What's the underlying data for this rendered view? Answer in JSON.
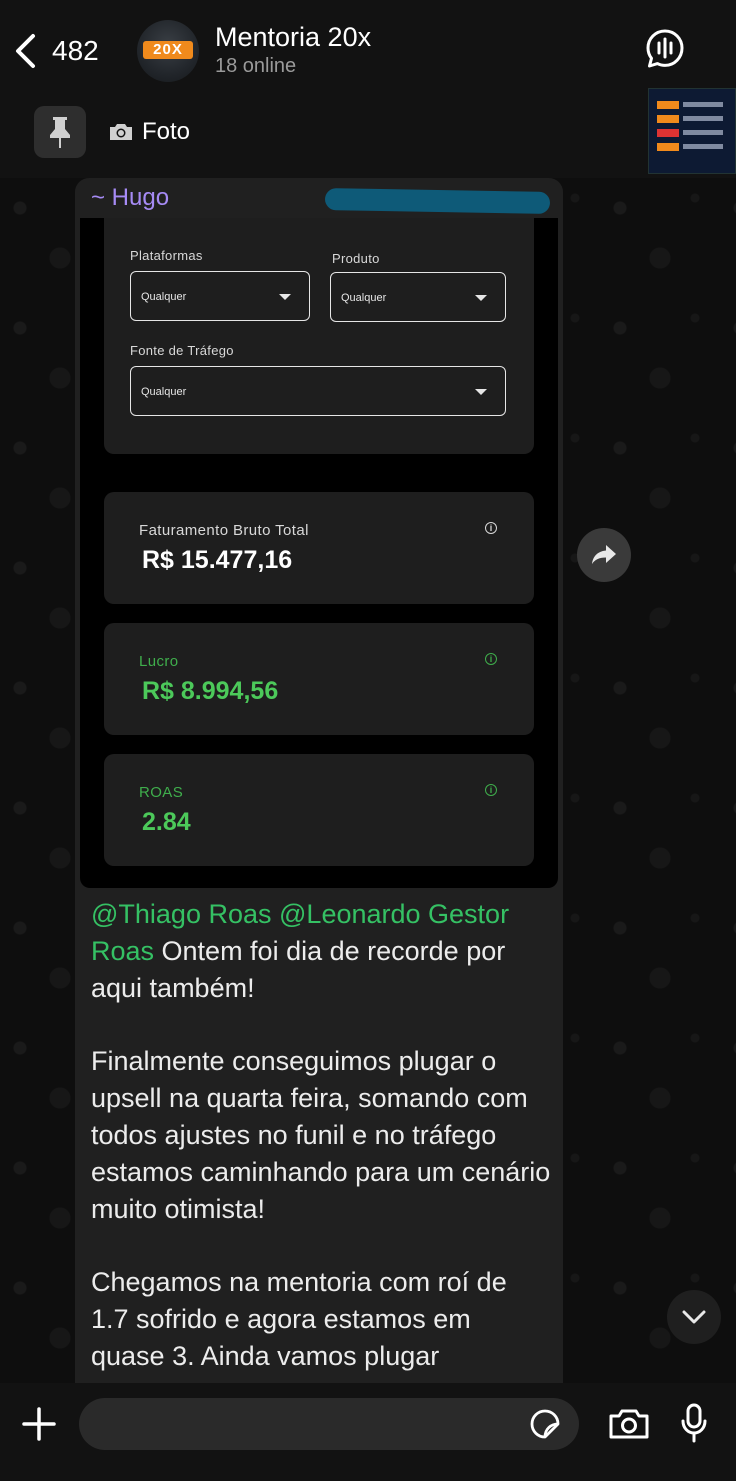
{
  "header": {
    "back_count": "482",
    "avatar_badge": "20X",
    "title": "Mentoria 20x",
    "status": "18 online"
  },
  "pinned": {
    "label": "Foto"
  },
  "message": {
    "sender": "~ Hugo",
    "screenshot": {
      "filters": [
        {
          "label": "Plataformas",
          "value": "Qualquer"
        },
        {
          "label": "Produto",
          "value": "Qualquer"
        },
        {
          "label": "Fonte de Tráfego",
          "value": "Qualquer"
        }
      ],
      "metrics": [
        {
          "label": "Faturamento Bruto Total",
          "value": "R$ 15.477,16",
          "color": "#ffffff",
          "label_color": "#d8d8d8"
        },
        {
          "label": "Lucro",
          "value": "R$ 8.994,56",
          "color": "#4cc95a",
          "label_color": "#3fae4c"
        },
        {
          "label": "ROAS",
          "value": "2.84",
          "color": "#4cc95a",
          "label_color": "#3fae4c"
        }
      ]
    },
    "mention_1": "@Thiago Roas",
    "mention_2": "@Leonardo Gestor Roas",
    "paragraph_1_rest": " Ontem foi dia de recorde por aqui também!",
    "paragraph_2": "Finalmente conseguimos plugar o upsell na quarta feira, somando com todos ajustes no funil e no tráfego estamos caminhando para um cenário muito otimista!",
    "paragraph_3": "Chegamos na mentoria com roí de 1.7 sofrido e agora estamos em quase 3. Ainda vamos plugar"
  },
  "input": {
    "placeholder": ""
  },
  "colors": {
    "mention": "#35c164",
    "sender": "#a68bf5",
    "bubble": "#202020"
  },
  "icons": [
    "chevron-left-icon",
    "audio-chat-icon",
    "pin-icon",
    "camera-icon",
    "forward-icon",
    "chevron-down-icon",
    "plus-icon",
    "sticker-icon",
    "mic-icon"
  ]
}
